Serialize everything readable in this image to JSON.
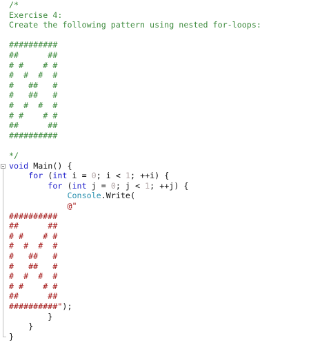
{
  "colors": {
    "comment": "#3c8a3c",
    "keyword": "#2222cc",
    "string": "#a31515",
    "number": "#b5a8a8",
    "class": "#2b91af",
    "plain": "#111111"
  },
  "editor": {
    "fold_icon": "collapse-minus-icon",
    "lines": [
      [
        {
          "t": "/*",
          "c": "comment"
        }
      ],
      [
        {
          "t": "Exercise 4:",
          "c": "comment"
        }
      ],
      [
        {
          "t": "Create the following pattern using nested for-loops:",
          "c": "comment"
        }
      ],
      [],
      [
        {
          "t": "##########",
          "c": "comment"
        }
      ],
      [
        {
          "t": "##      ##",
          "c": "comment"
        }
      ],
      [
        {
          "t": "# #    # #",
          "c": "comment"
        }
      ],
      [
        {
          "t": "#  #  #  #",
          "c": "comment"
        }
      ],
      [
        {
          "t": "#   ##   #",
          "c": "comment"
        }
      ],
      [
        {
          "t": "#   ##   #",
          "c": "comment"
        }
      ],
      [
        {
          "t": "#  #  #  #",
          "c": "comment"
        }
      ],
      [
        {
          "t": "# #    # #",
          "c": "comment"
        }
      ],
      [
        {
          "t": "##      ##",
          "c": "comment"
        }
      ],
      [
        {
          "t": "##########",
          "c": "comment"
        }
      ],
      [],
      [
        {
          "t": "*/",
          "c": "comment"
        }
      ],
      [
        {
          "t": "void",
          "c": "keyword"
        },
        {
          "t": " Main() {",
          "c": "plain"
        }
      ],
      [
        {
          "t": "    ",
          "c": "plain"
        },
        {
          "t": "for",
          "c": "keyword"
        },
        {
          "t": " (",
          "c": "plain"
        },
        {
          "t": "int",
          "c": "keyword"
        },
        {
          "t": " i = ",
          "c": "plain"
        },
        {
          "t": "0",
          "c": "number"
        },
        {
          "t": "; i < ",
          "c": "plain"
        },
        {
          "t": "1",
          "c": "number"
        },
        {
          "t": "; ++i) {",
          "c": "plain"
        }
      ],
      [
        {
          "t": "        ",
          "c": "plain"
        },
        {
          "t": "for",
          "c": "keyword"
        },
        {
          "t": " (",
          "c": "plain"
        },
        {
          "t": "int",
          "c": "keyword"
        },
        {
          "t": " j = ",
          "c": "plain"
        },
        {
          "t": "0",
          "c": "number"
        },
        {
          "t": "; j < ",
          "c": "plain"
        },
        {
          "t": "1",
          "c": "number"
        },
        {
          "t": "; ++j) {",
          "c": "plain"
        }
      ],
      [
        {
          "t": "            ",
          "c": "plain"
        },
        {
          "t": "Console",
          "c": "class"
        },
        {
          "t": ".Write(",
          "c": "plain"
        }
      ],
      [
        {
          "t": "            ",
          "c": "plain"
        },
        {
          "t": "@\"",
          "c": "string"
        }
      ],
      [
        {
          "t": "##########",
          "c": "string"
        }
      ],
      [
        {
          "t": "##      ##",
          "c": "string"
        }
      ],
      [
        {
          "t": "# #    # #",
          "c": "string"
        }
      ],
      [
        {
          "t": "#  #  #  #",
          "c": "string"
        }
      ],
      [
        {
          "t": "#   ##   #",
          "c": "string"
        }
      ],
      [
        {
          "t": "#   ##   #",
          "c": "string"
        }
      ],
      [
        {
          "t": "#  #  #  #",
          "c": "string"
        }
      ],
      [
        {
          "t": "# #    # #",
          "c": "string"
        }
      ],
      [
        {
          "t": "##      ##",
          "c": "string"
        }
      ],
      [
        {
          "t": "##########\"",
          "c": "string"
        },
        {
          "t": ");",
          "c": "plain"
        }
      ],
      [
        {
          "t": "        }",
          "c": "plain"
        }
      ],
      [
        {
          "t": "    }",
          "c": "plain"
        }
      ],
      [
        {
          "t": "}",
          "c": "plain"
        }
      ]
    ]
  }
}
